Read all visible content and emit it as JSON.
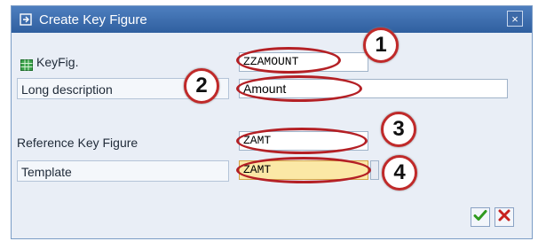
{
  "window": {
    "title": "Create Key Figure",
    "close_glyph": "×",
    "title_icon": "create-document-icon"
  },
  "fields": {
    "keyfig": {
      "label": "KeyFig.",
      "value": "ZZAMOUNT",
      "icon": "keyfigure-icon"
    },
    "long_description": {
      "label": "Long description",
      "value": "Amount"
    },
    "reference_key_figure": {
      "label": "Reference Key Figure",
      "value": "ZAMT"
    },
    "template": {
      "label": "Template",
      "value": "ZAMT"
    }
  },
  "annotations": [
    "1",
    "2",
    "3",
    "4"
  ],
  "buttons": {
    "confirm_icon": "checkmark-icon",
    "cancel_icon": "cancel-x-icon"
  },
  "colors": {
    "annotation": "#b42025",
    "title_bar": "#3a6aad",
    "template_highlight": "#fbe8a6"
  }
}
